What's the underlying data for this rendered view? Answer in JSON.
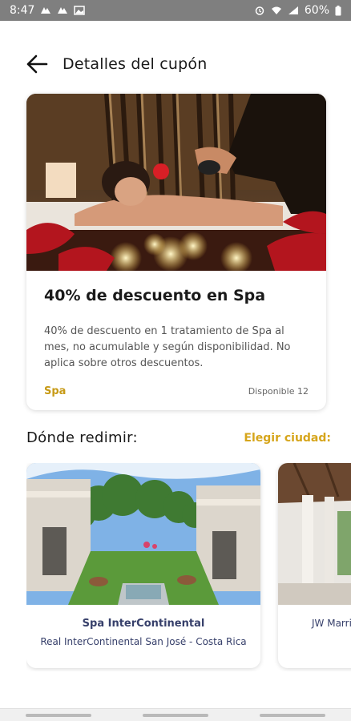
{
  "status_bar": {
    "time": "8:47",
    "battery": "60%"
  },
  "header": {
    "title": "Detalles del cupón"
  },
  "coupon": {
    "title": "40% de descuento en Spa",
    "description": "40% de descuento en 1 tratamiento de Spa al mes, no acumulable y según disponibilidad. No aplica sobre otros descuentos.",
    "category": "Spa",
    "availability": "Disponible 12"
  },
  "redeem": {
    "title": "Dónde redimir:",
    "city_link": "Elegir ciudad:",
    "places": [
      {
        "name": "Spa InterContinental",
        "location": "Real InterContinental San José - Costa Rica"
      },
      {
        "name": "",
        "location": "JW Marriott"
      }
    ]
  },
  "colors": {
    "accent": "#d6a51b",
    "place_text": "#37406b"
  }
}
